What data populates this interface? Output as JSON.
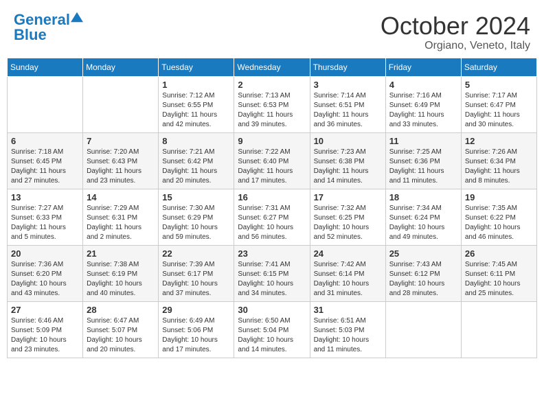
{
  "header": {
    "logo_line1": "General",
    "logo_line2": "Blue",
    "month": "October 2024",
    "location": "Orgiano, Veneto, Italy"
  },
  "weekdays": [
    "Sunday",
    "Monday",
    "Tuesday",
    "Wednesday",
    "Thursday",
    "Friday",
    "Saturday"
  ],
  "weeks": [
    [
      {
        "day": "",
        "sunrise": "",
        "sunset": "",
        "daylight": ""
      },
      {
        "day": "",
        "sunrise": "",
        "sunset": "",
        "daylight": ""
      },
      {
        "day": "1",
        "sunrise": "Sunrise: 7:12 AM",
        "sunset": "Sunset: 6:55 PM",
        "daylight": "Daylight: 11 hours and 42 minutes."
      },
      {
        "day": "2",
        "sunrise": "Sunrise: 7:13 AM",
        "sunset": "Sunset: 6:53 PM",
        "daylight": "Daylight: 11 hours and 39 minutes."
      },
      {
        "day": "3",
        "sunrise": "Sunrise: 7:14 AM",
        "sunset": "Sunset: 6:51 PM",
        "daylight": "Daylight: 11 hours and 36 minutes."
      },
      {
        "day": "4",
        "sunrise": "Sunrise: 7:16 AM",
        "sunset": "Sunset: 6:49 PM",
        "daylight": "Daylight: 11 hours and 33 minutes."
      },
      {
        "day": "5",
        "sunrise": "Sunrise: 7:17 AM",
        "sunset": "Sunset: 6:47 PM",
        "daylight": "Daylight: 11 hours and 30 minutes."
      }
    ],
    [
      {
        "day": "6",
        "sunrise": "Sunrise: 7:18 AM",
        "sunset": "Sunset: 6:45 PM",
        "daylight": "Daylight: 11 hours and 27 minutes."
      },
      {
        "day": "7",
        "sunrise": "Sunrise: 7:20 AM",
        "sunset": "Sunset: 6:43 PM",
        "daylight": "Daylight: 11 hours and 23 minutes."
      },
      {
        "day": "8",
        "sunrise": "Sunrise: 7:21 AM",
        "sunset": "Sunset: 6:42 PM",
        "daylight": "Daylight: 11 hours and 20 minutes."
      },
      {
        "day": "9",
        "sunrise": "Sunrise: 7:22 AM",
        "sunset": "Sunset: 6:40 PM",
        "daylight": "Daylight: 11 hours and 17 minutes."
      },
      {
        "day": "10",
        "sunrise": "Sunrise: 7:23 AM",
        "sunset": "Sunset: 6:38 PM",
        "daylight": "Daylight: 11 hours and 14 minutes."
      },
      {
        "day": "11",
        "sunrise": "Sunrise: 7:25 AM",
        "sunset": "Sunset: 6:36 PM",
        "daylight": "Daylight: 11 hours and 11 minutes."
      },
      {
        "day": "12",
        "sunrise": "Sunrise: 7:26 AM",
        "sunset": "Sunset: 6:34 PM",
        "daylight": "Daylight: 11 hours and 8 minutes."
      }
    ],
    [
      {
        "day": "13",
        "sunrise": "Sunrise: 7:27 AM",
        "sunset": "Sunset: 6:33 PM",
        "daylight": "Daylight: 11 hours and 5 minutes."
      },
      {
        "day": "14",
        "sunrise": "Sunrise: 7:29 AM",
        "sunset": "Sunset: 6:31 PM",
        "daylight": "Daylight: 11 hours and 2 minutes."
      },
      {
        "day": "15",
        "sunrise": "Sunrise: 7:30 AM",
        "sunset": "Sunset: 6:29 PM",
        "daylight": "Daylight: 10 hours and 59 minutes."
      },
      {
        "day": "16",
        "sunrise": "Sunrise: 7:31 AM",
        "sunset": "Sunset: 6:27 PM",
        "daylight": "Daylight: 10 hours and 56 minutes."
      },
      {
        "day": "17",
        "sunrise": "Sunrise: 7:32 AM",
        "sunset": "Sunset: 6:25 PM",
        "daylight": "Daylight: 10 hours and 52 minutes."
      },
      {
        "day": "18",
        "sunrise": "Sunrise: 7:34 AM",
        "sunset": "Sunset: 6:24 PM",
        "daylight": "Daylight: 10 hours and 49 minutes."
      },
      {
        "day": "19",
        "sunrise": "Sunrise: 7:35 AM",
        "sunset": "Sunset: 6:22 PM",
        "daylight": "Daylight: 10 hours and 46 minutes."
      }
    ],
    [
      {
        "day": "20",
        "sunrise": "Sunrise: 7:36 AM",
        "sunset": "Sunset: 6:20 PM",
        "daylight": "Daylight: 10 hours and 43 minutes."
      },
      {
        "day": "21",
        "sunrise": "Sunrise: 7:38 AM",
        "sunset": "Sunset: 6:19 PM",
        "daylight": "Daylight: 10 hours and 40 minutes."
      },
      {
        "day": "22",
        "sunrise": "Sunrise: 7:39 AM",
        "sunset": "Sunset: 6:17 PM",
        "daylight": "Daylight: 10 hours and 37 minutes."
      },
      {
        "day": "23",
        "sunrise": "Sunrise: 7:41 AM",
        "sunset": "Sunset: 6:15 PM",
        "daylight": "Daylight: 10 hours and 34 minutes."
      },
      {
        "day": "24",
        "sunrise": "Sunrise: 7:42 AM",
        "sunset": "Sunset: 6:14 PM",
        "daylight": "Daylight: 10 hours and 31 minutes."
      },
      {
        "day": "25",
        "sunrise": "Sunrise: 7:43 AM",
        "sunset": "Sunset: 6:12 PM",
        "daylight": "Daylight: 10 hours and 28 minutes."
      },
      {
        "day": "26",
        "sunrise": "Sunrise: 7:45 AM",
        "sunset": "Sunset: 6:11 PM",
        "daylight": "Daylight: 10 hours and 25 minutes."
      }
    ],
    [
      {
        "day": "27",
        "sunrise": "Sunrise: 6:46 AM",
        "sunset": "Sunset: 5:09 PM",
        "daylight": "Daylight: 10 hours and 23 minutes."
      },
      {
        "day": "28",
        "sunrise": "Sunrise: 6:47 AM",
        "sunset": "Sunset: 5:07 PM",
        "daylight": "Daylight: 10 hours and 20 minutes."
      },
      {
        "day": "29",
        "sunrise": "Sunrise: 6:49 AM",
        "sunset": "Sunset: 5:06 PM",
        "daylight": "Daylight: 10 hours and 17 minutes."
      },
      {
        "day": "30",
        "sunrise": "Sunrise: 6:50 AM",
        "sunset": "Sunset: 5:04 PM",
        "daylight": "Daylight: 10 hours and 14 minutes."
      },
      {
        "day": "31",
        "sunrise": "Sunrise: 6:51 AM",
        "sunset": "Sunset: 5:03 PM",
        "daylight": "Daylight: 10 hours and 11 minutes."
      },
      {
        "day": "",
        "sunrise": "",
        "sunset": "",
        "daylight": ""
      },
      {
        "day": "",
        "sunrise": "",
        "sunset": "",
        "daylight": ""
      }
    ]
  ]
}
